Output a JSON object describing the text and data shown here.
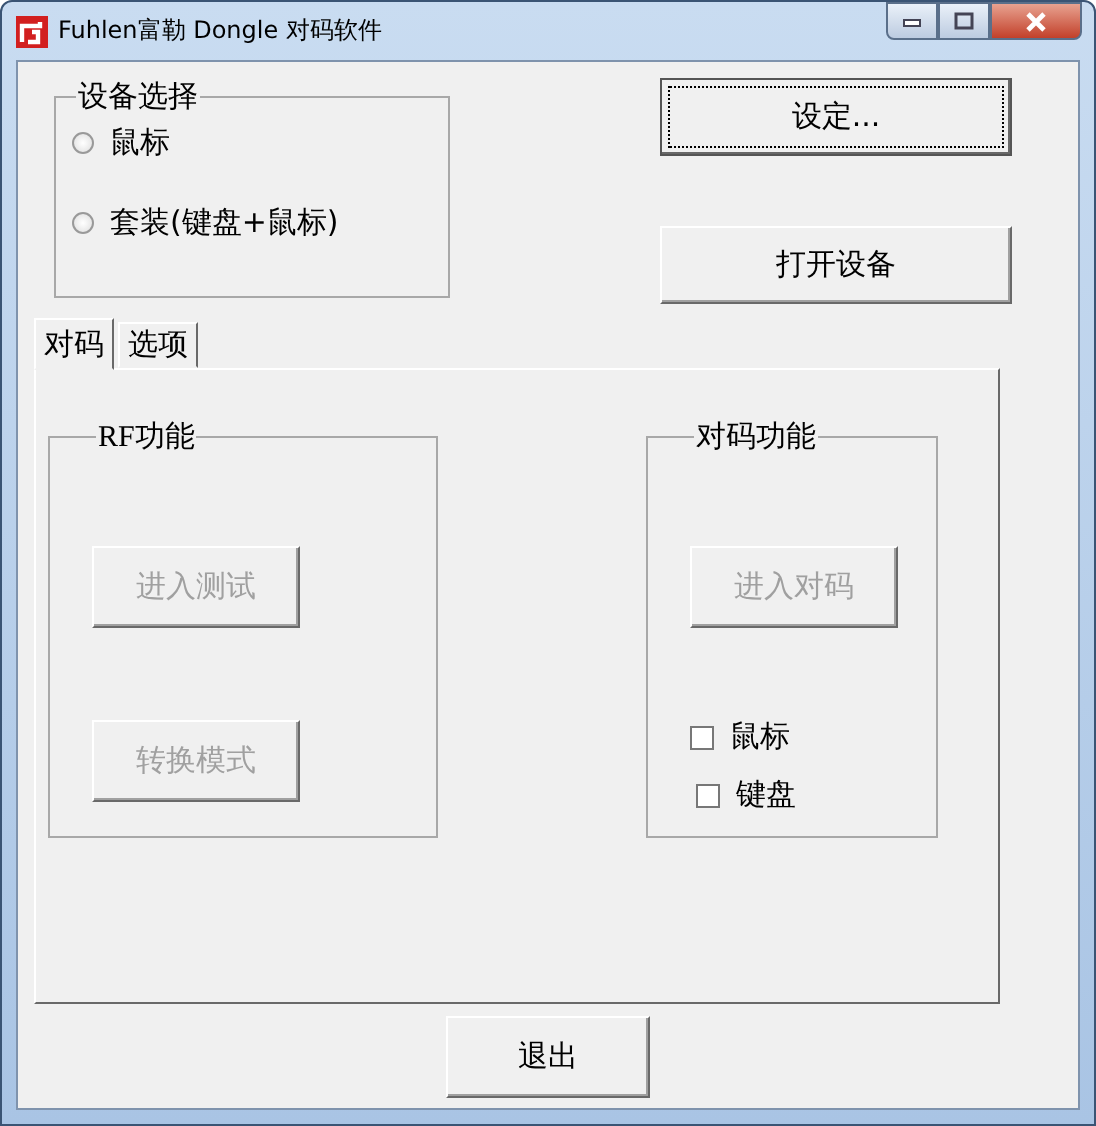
{
  "window": {
    "title": "Fuhlen富勒 Dongle 对码软件"
  },
  "device_group": {
    "title": "设备选择",
    "options": [
      {
        "label": "鼠标",
        "selected": false
      },
      {
        "label": "套装(键盘+鼠标)",
        "selected": false
      }
    ]
  },
  "top_buttons": [
    {
      "label": "设定...",
      "focused": true
    },
    {
      "label": "打开设备",
      "focused": false
    }
  ],
  "tabs": [
    {
      "label": "对码",
      "selected": true
    },
    {
      "label": "选项",
      "selected": false
    }
  ],
  "rf_group": {
    "title": "RF功能",
    "buttons": [
      {
        "label": "进入测试",
        "disabled": true
      },
      {
        "label": "转换模式",
        "disabled": true
      }
    ]
  },
  "pair_group": {
    "title": "对码功能",
    "button": {
      "label": "进入对码",
      "disabled": true
    },
    "checkboxes": [
      {
        "label": "鼠标",
        "checked": false
      },
      {
        "label": "键盘",
        "checked": false
      }
    ]
  },
  "exit_button": {
    "label": "退出"
  }
}
